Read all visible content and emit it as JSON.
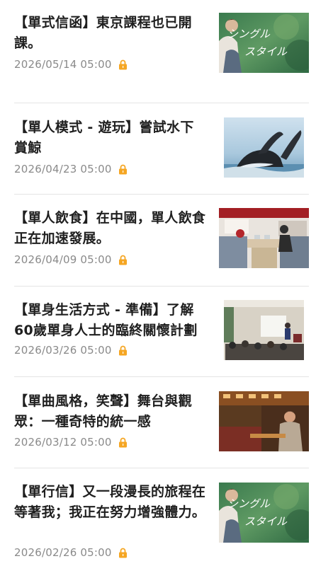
{
  "articles": [
    {
      "title": "【單式信函】東京課程也已開課。",
      "date": "2026/05/14 05:00",
      "thumb": "single-style-photo",
      "thumb_text_1": "シングル",
      "thumb_text_2": "スタイル"
    },
    {
      "title": "【單人模式 - 遊玩】嘗試水下賞鯨",
      "date": "2026/04/23 05:00",
      "thumb": "whale-photo"
    },
    {
      "title": "【單人飲食】在中國，單人飲食正在加速發展。",
      "date": "2026/04/09 05:00",
      "thumb": "restaurant-booth-photo"
    },
    {
      "title": "【單身生活方式 - 準備】了解60歲單身人士的臨終關懷計劃",
      "date": "2026/03/26 05:00",
      "thumb": "seminar-room-photo"
    },
    {
      "title": "【單曲風格，笑聲】舞台與觀眾：一種奇特的統一感",
      "date": "2026/03/12 05:00",
      "thumb": "theater-audience-photo"
    },
    {
      "title": "【單行信】又一段漫長的旅程在等著我；我正在努力增強體力。",
      "date": "2026/02/26 05:00",
      "thumb": "single-style-photo",
      "thumb_text_1": "シングル",
      "thumb_text_2": "スタイル"
    }
  ],
  "colors": {
    "lock": "#f5a623",
    "date": "#8a8a8a",
    "title": "#1f1f1f",
    "separator": "#e4e4e4"
  },
  "icons": {
    "premium": "lock-icon"
  }
}
